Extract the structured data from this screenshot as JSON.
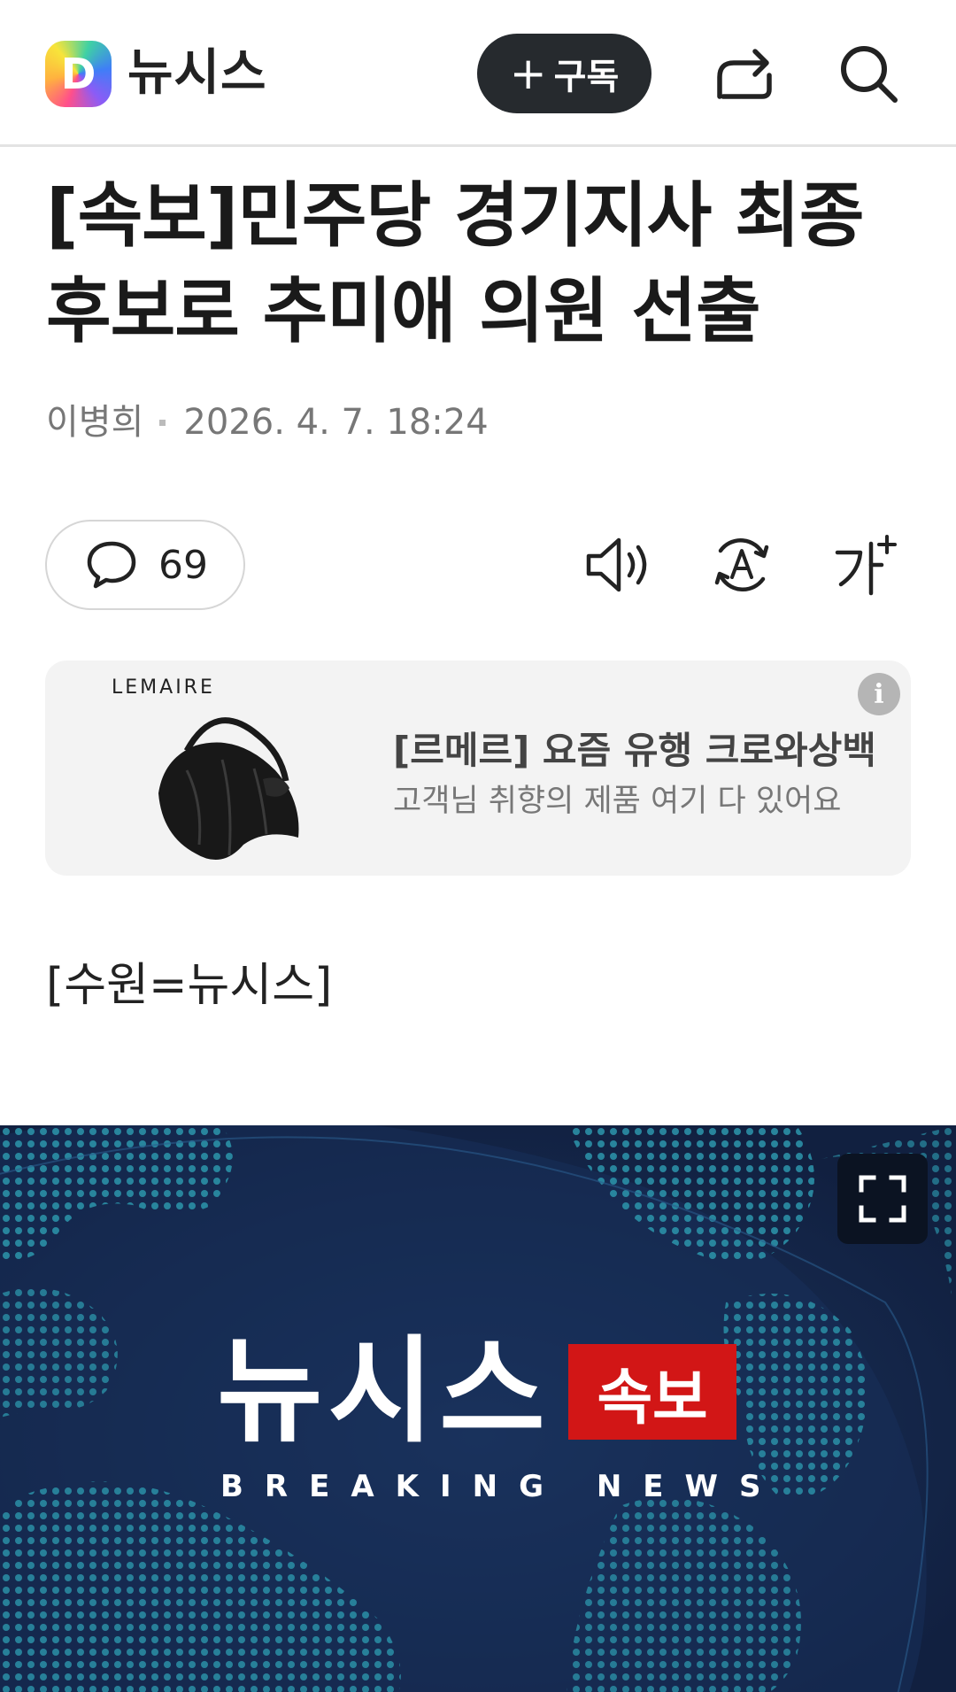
{
  "header": {
    "logo_letter": "D",
    "app_name": "뉴시스",
    "subscribe_plus": "+",
    "subscribe_label": "구독"
  },
  "article": {
    "headline": "[속보]민주당 경기지사 최종 후보로 추미애 의원 선출",
    "author": "이병희",
    "timestamp": "2026. 4. 7. 18:24",
    "comment_count": "69",
    "dateline": "[수원=뉴시스]"
  },
  "ad": {
    "brand": "LEMAIRE",
    "title": "[르메르] 요즘 유행 크로와상백",
    "subtitle": "고객님 취향의 제품 여기 다 있어요",
    "info_icon": "i"
  },
  "image": {
    "wordmark": "뉴시스",
    "badge": "속보",
    "tagline": "BREAKING NEWS"
  },
  "icons": {
    "share": "share-icon",
    "search": "search-icon",
    "comment": "comment-icon",
    "tts": "speaker-icon",
    "translate": "translate-icon",
    "fontsize": "font-size-icon",
    "expand": "expand-icon"
  },
  "colors": {
    "subscribe_bg": "#262a2e",
    "image_bg": "#142544",
    "badge_red": "#d21616",
    "ad_bg": "#f3f3f3"
  }
}
